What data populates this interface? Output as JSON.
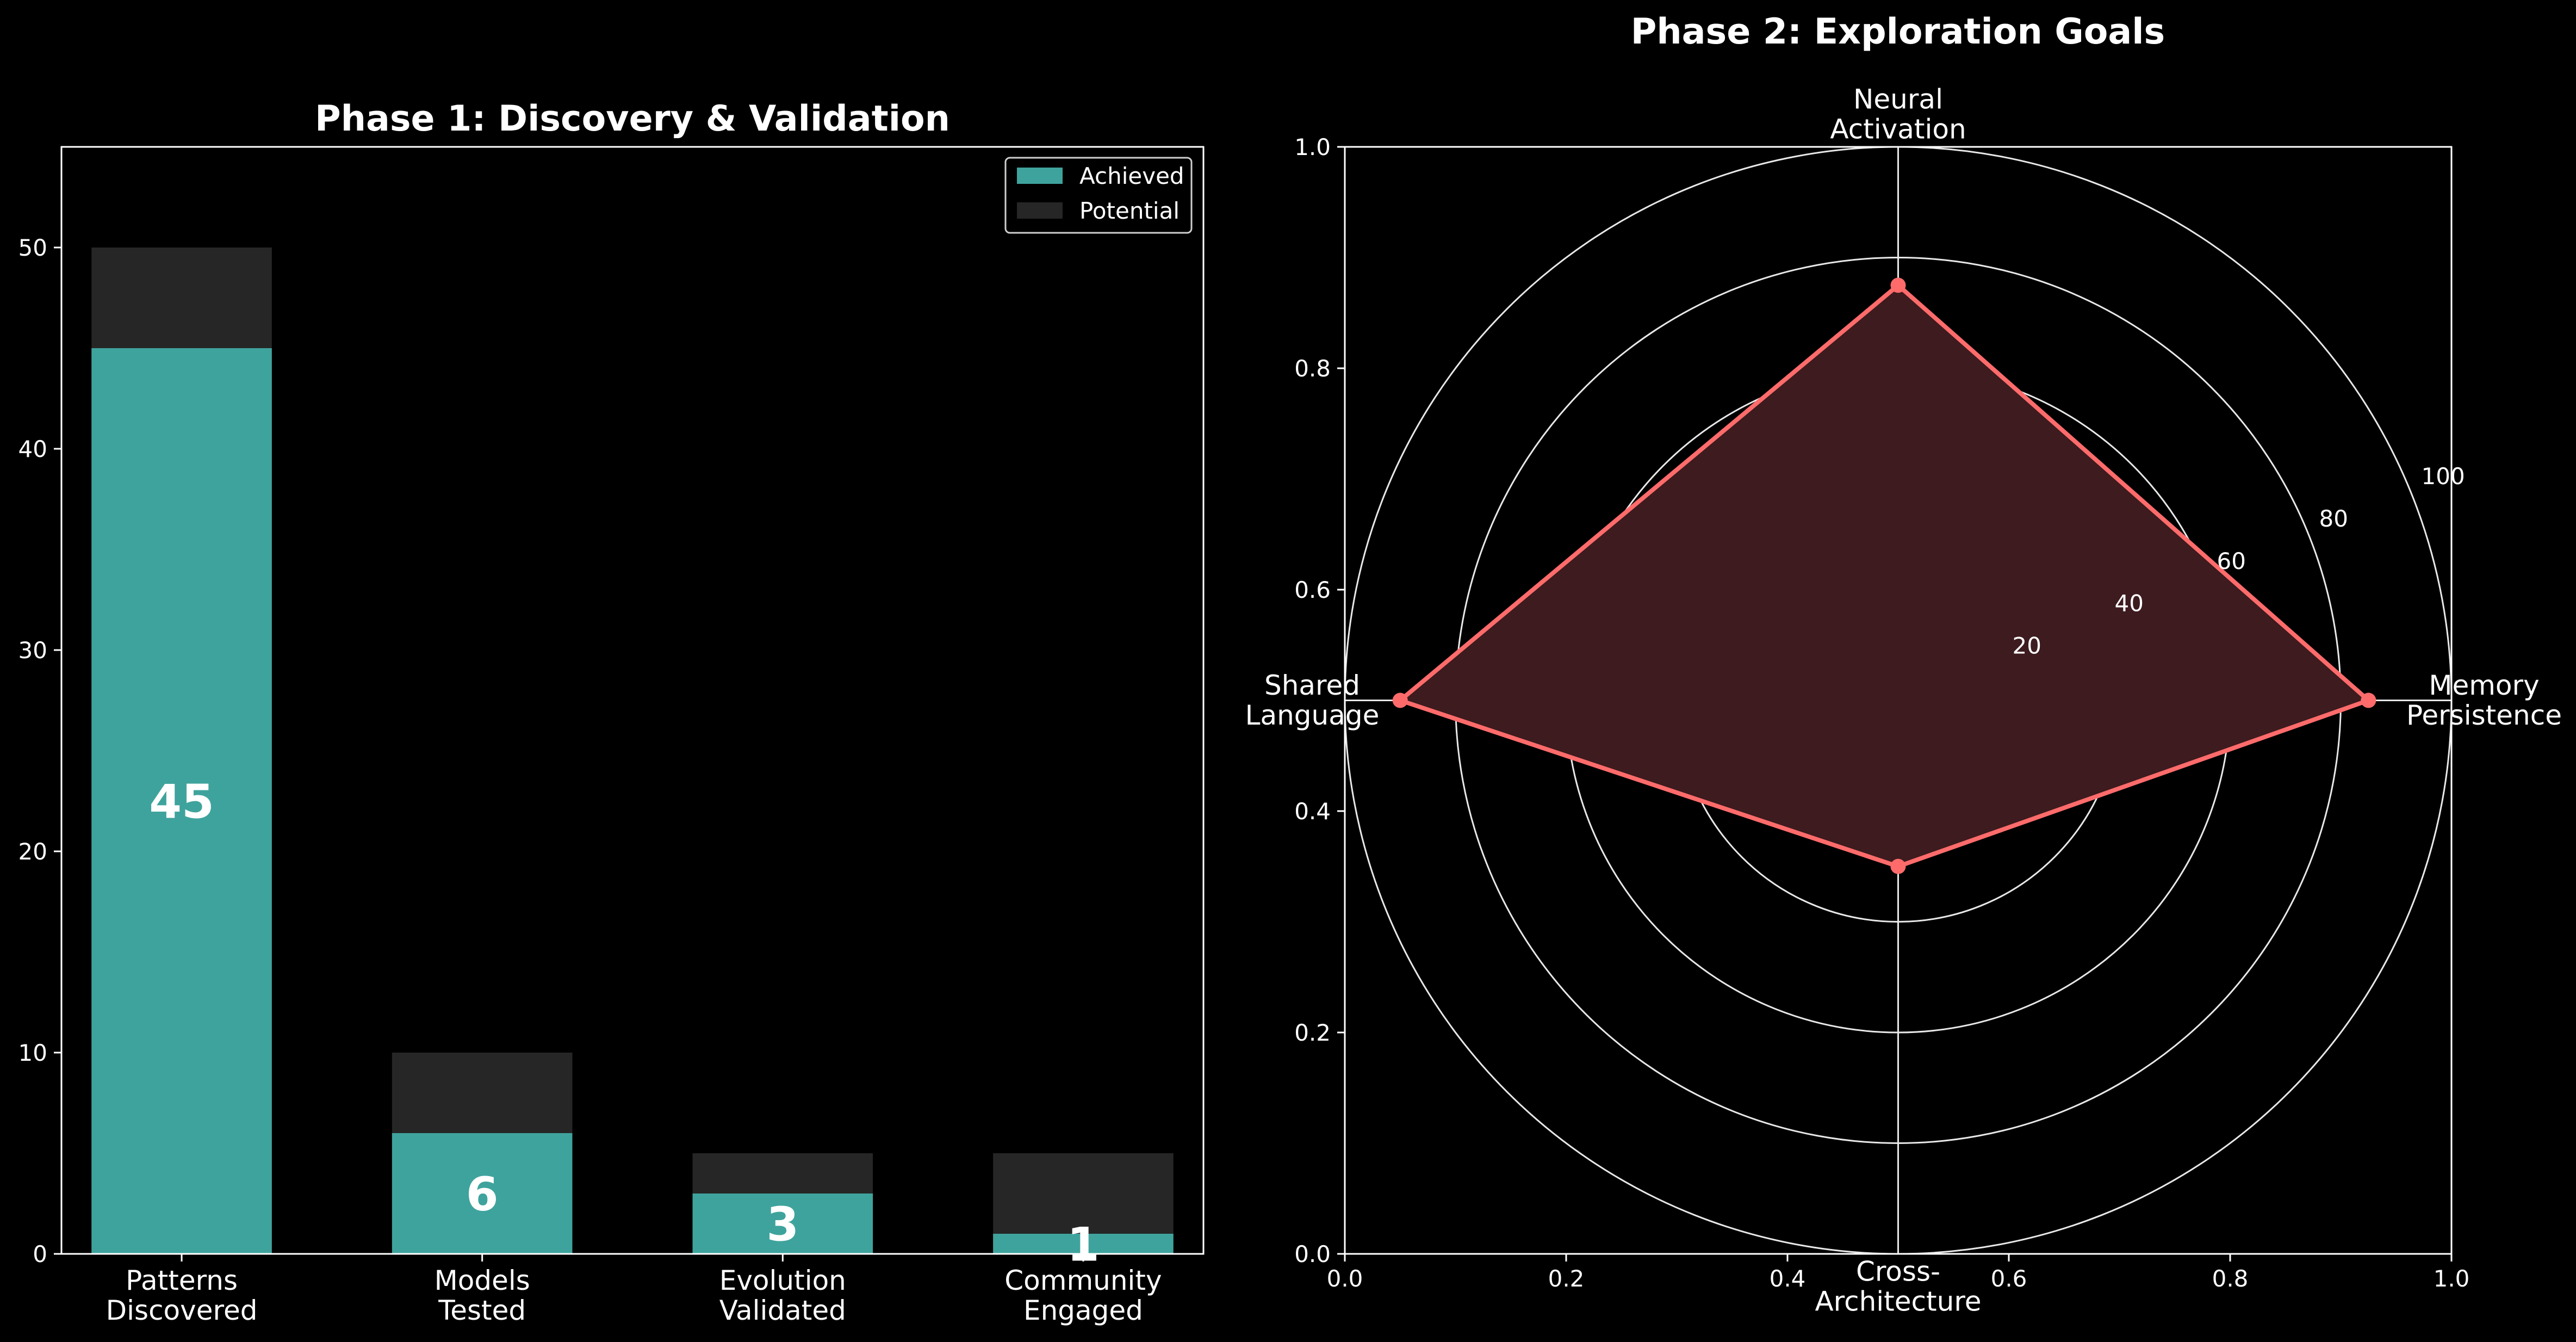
{
  "chart_data": [
    {
      "type": "bar",
      "title": "Phase 1: Discovery & Validation",
      "categories": [
        "Patterns\nDiscovered",
        "Models\nTested",
        "Evolution\nValidated",
        "Community\nEngaged"
      ],
      "series": [
        {
          "name": "Achieved",
          "values": [
            45,
            6,
            3,
            1
          ],
          "color": "#3fa39d"
        },
        {
          "name": "Potential",
          "values": [
            50,
            10,
            5,
            5
          ],
          "color": "#262626"
        }
      ],
      "bar_labels": [
        "45",
        "6",
        "3",
        "1"
      ],
      "ylim": [
        0,
        55
      ],
      "yticks": [
        0,
        10,
        20,
        30,
        40,
        50
      ],
      "stacked": "overlay",
      "legend": "top-right",
      "grid": false
    },
    {
      "type": "radar",
      "title": "Phase 2: Exploration Goals",
      "axes": [
        "Neural\nActivation",
        "Memory\nPersistence",
        "Cross-\nArchitecture",
        "Shared\nLanguage"
      ],
      "values": [
        75,
        85,
        30,
        90
      ],
      "rlim": [
        0,
        100
      ],
      "rticks": [
        20,
        40,
        60,
        80,
        100
      ],
      "cartesian_xticks": [
        "0.0",
        "0.2",
        "0.4",
        "0.6",
        "0.8",
        "1.0"
      ],
      "cartesian_yticks": [
        "0.0",
        "0.2",
        "0.4",
        "0.6",
        "0.8",
        "1.0"
      ],
      "line_color": "#ff6b6b",
      "fill_color": "#3d1b1e",
      "grid": true
    }
  ]
}
